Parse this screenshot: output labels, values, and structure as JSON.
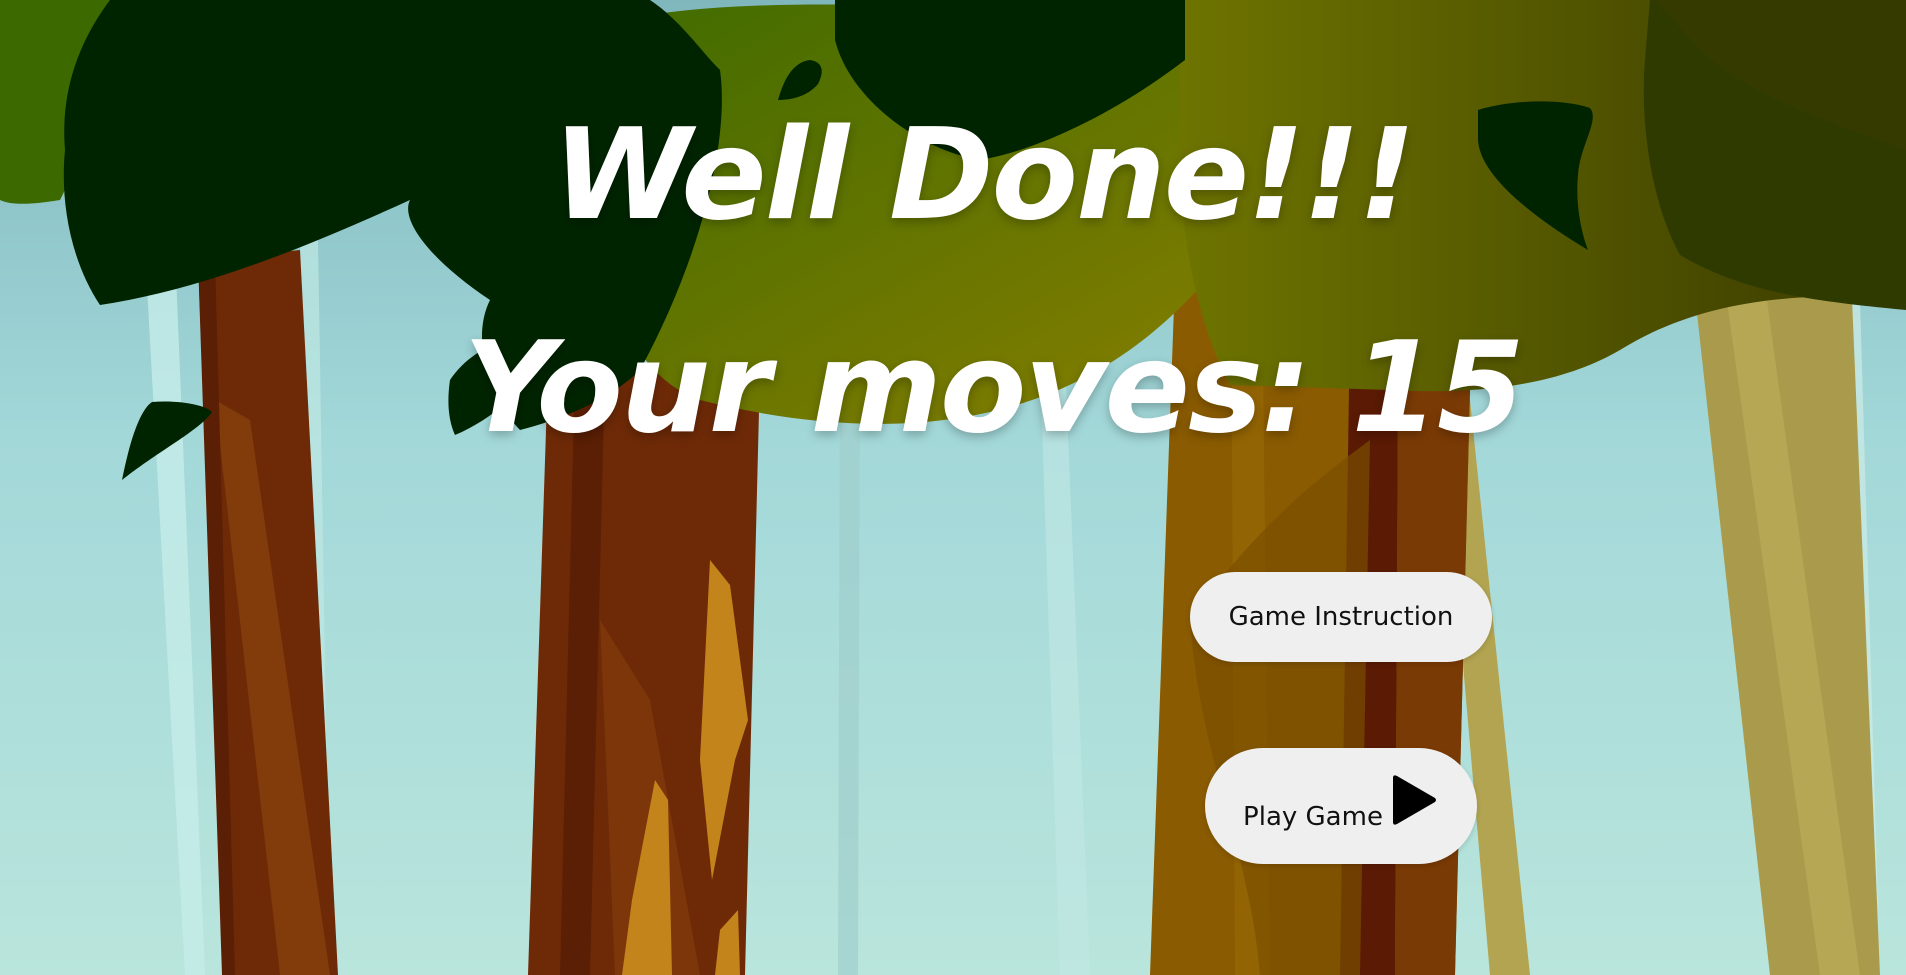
{
  "screen": {
    "headline": "Well Done!!!",
    "moves_label": "Your moves:",
    "moves_count": "15"
  },
  "buttons": {
    "instruction_label": "Game Instruction",
    "play_label": "Play Game",
    "play_icon": "play-triangle-icon"
  },
  "colors": {
    "text": "#ffffff",
    "button_bg": "#efefef",
    "button_text": "#111111",
    "sky": "#a8dcd8",
    "dark_leaves": "#002400",
    "olive_leaves": "#7a7c00",
    "trunk_brown": "#6e2c07"
  }
}
